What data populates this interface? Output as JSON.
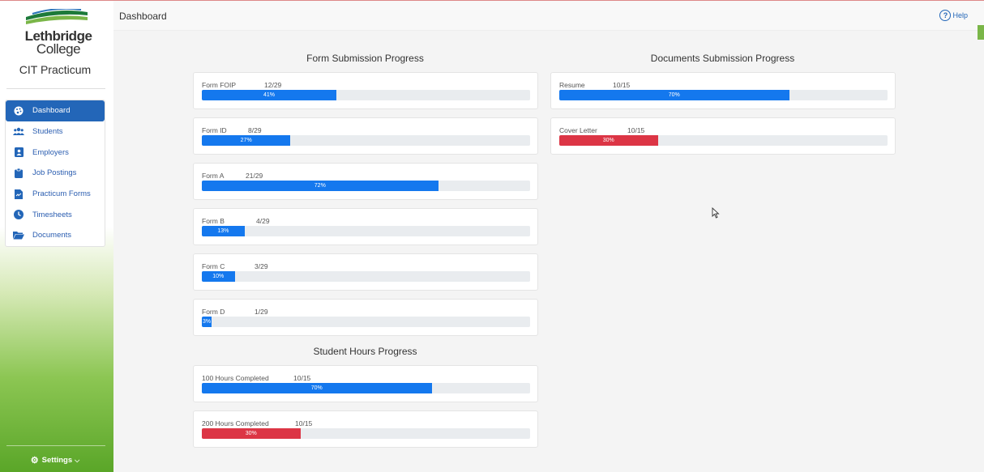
{
  "sidebar": {
    "logo": {
      "line1": "Lethbridge",
      "line2": "College"
    },
    "app_title": "CIT Practicum",
    "items": [
      {
        "label": "Dashboard",
        "icon": "palette-icon",
        "active": true
      },
      {
        "label": "Students",
        "icon": "users-icon",
        "active": false
      },
      {
        "label": "Employers",
        "icon": "id-badge-icon",
        "active": false
      },
      {
        "label": "Job Postings",
        "icon": "clipboard-icon",
        "active": false
      },
      {
        "label": "Practicum Forms",
        "icon": "file-signature-icon",
        "active": false
      },
      {
        "label": "Timesheets",
        "icon": "clock-icon",
        "active": false
      },
      {
        "label": "Documents",
        "icon": "folder-open-icon",
        "active": false
      }
    ],
    "settings_label": "Settings"
  },
  "header": {
    "title": "Dashboard",
    "help_label": "Help"
  },
  "form_section": {
    "title": "Form Submission Progress",
    "items": [
      {
        "label": "Form FOIP",
        "count": "12/29",
        "percent": 41,
        "percent_label": "41%",
        "color": "#1478ee"
      },
      {
        "label": "Form ID",
        "count": "8/29",
        "percent": 27,
        "percent_label": "27%",
        "color": "#1478ee"
      },
      {
        "label": "Form A",
        "count": "21/29",
        "percent": 72,
        "percent_label": "72%",
        "color": "#1478ee"
      },
      {
        "label": "Form B",
        "count": "4/29",
        "percent": 13,
        "percent_label": "13%",
        "color": "#1478ee"
      },
      {
        "label": "Form C",
        "count": "3/29",
        "percent": 10,
        "percent_label": "10%",
        "color": "#1478ee"
      },
      {
        "label": "Form D",
        "count": "1/29",
        "percent": 3,
        "percent_label": "3%",
        "color": "#1478ee"
      }
    ]
  },
  "hours_section": {
    "title": "Student Hours Progress",
    "items": [
      {
        "label": "100 Hours Completed",
        "count": "10/15",
        "percent": 70,
        "percent_label": "70%",
        "color": "#1478ee"
      },
      {
        "label": "200 Hours Completed",
        "count": "10/15",
        "percent": 30,
        "percent_label": "30%",
        "color": "#dc3545"
      }
    ]
  },
  "documents_section": {
    "title": "Documents Submission Progress",
    "items": [
      {
        "label": "Resume",
        "count": "10/15",
        "percent": 70,
        "percent_label": "70%",
        "color": "#1478ee"
      },
      {
        "label": "Cover Letter",
        "count": "10/15",
        "percent": 30,
        "percent_label": "30%",
        "color": "#dc3545"
      }
    ]
  },
  "colors": {
    "primary": "#2366b8",
    "progress_blue": "#1478ee",
    "progress_red": "#dc3545",
    "sidebar_green": "#5aa628"
  }
}
